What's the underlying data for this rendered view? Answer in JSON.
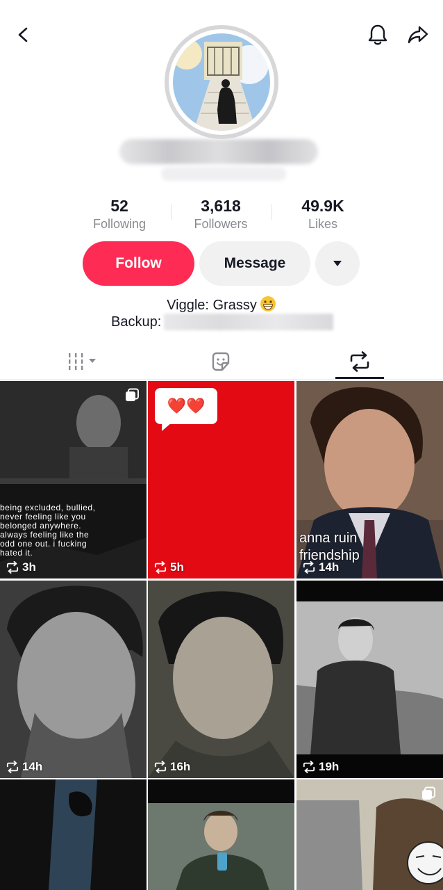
{
  "header": {
    "back_icon": "chevron-left-icon",
    "bell_icon": "bell-icon",
    "share_icon": "share-arrow-icon"
  },
  "stats": {
    "following": {
      "value": "52",
      "label": "Following"
    },
    "followers": {
      "value": "3,618",
      "label": "Followers"
    },
    "likes": {
      "value": "49.9K",
      "label": "Likes"
    }
  },
  "actions": {
    "follow_label": "Follow",
    "message_label": "Message",
    "more_icon": "caret-down-icon"
  },
  "bio": {
    "line1": "Viggle: Grassy",
    "line1_emoji": "grinning-face-emoji",
    "backup_label": "Backup:"
  },
  "tabs": [
    {
      "name": "videos",
      "icon": "grid-bars-icon"
    },
    {
      "name": "stickers",
      "icon": "sticker-icon"
    },
    {
      "name": "reposts",
      "icon": "repost-icon",
      "active": true
    }
  ],
  "colors": {
    "accent": "#fe2c55",
    "secondary_button": "#f1f1f2",
    "muted_text": "#8a8b91"
  },
  "posts": [
    {
      "time": "3h",
      "overlay": "being excluded, bullied,\nnever feeling like you\nbelonged anywhere.\nalways feeling like the\nodd one out. i fucking\nhated it.",
      "multi": true
    },
    {
      "time": "5h",
      "overlay": "❤️❤️"
    },
    {
      "time": "14h",
      "overlay": "anna ruin\nfriendship"
    },
    {
      "time": "14h"
    },
    {
      "time": "16h"
    },
    {
      "time": "19h"
    },
    {
      "time": ""
    },
    {
      "time": ""
    },
    {
      "time": "",
      "multi": true
    }
  ]
}
